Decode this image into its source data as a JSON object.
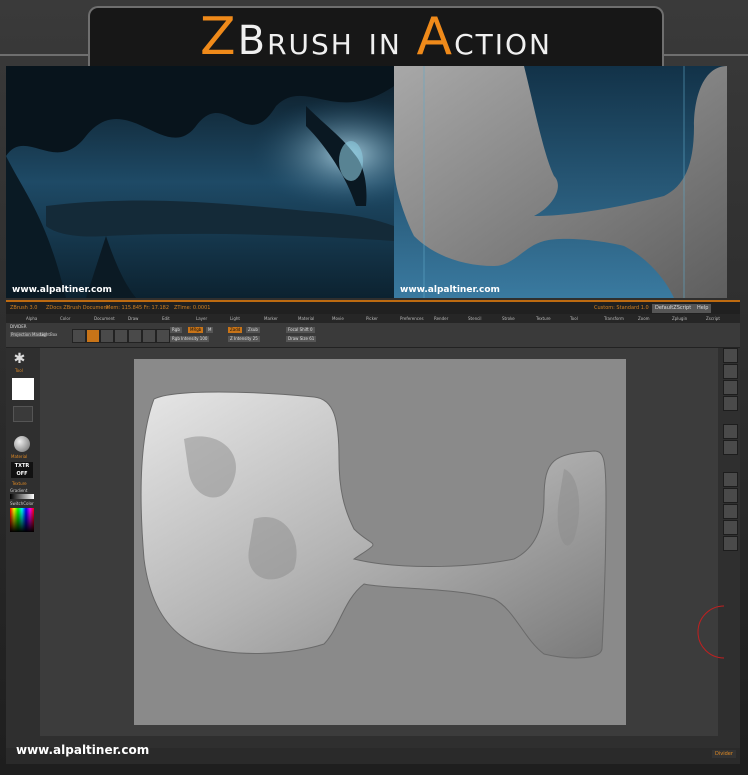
{
  "title": {
    "first_letter": "Z",
    "part1": "Brush in ",
    "second_letter": "A",
    "part2": "ction"
  },
  "images": {
    "left_watermark": "www.alpaltiner.com",
    "right_watermark": "www.alpaltiner.com"
  },
  "zbrush": {
    "titlebar": {
      "app": "ZBrush 3.0",
      "document": "ZDocs ZBrush Document",
      "mem": "Mem: 115.845 Fr: 17.182",
      "ztime": "ZTime: 0.0001",
      "right_label": "Custom: Standard 1.0",
      "btn1": "DefaultZScript",
      "btn2": "Help"
    },
    "menu": [
      "Alpha",
      "Color",
      "Document",
      "Draw",
      "Edit",
      "Layer",
      "Light",
      "Marker",
      "Material",
      "Movie",
      "Picker",
      "Preferences",
      "Render",
      "Stencil",
      "Stroke",
      "Texture",
      "Tool",
      "Transform",
      "Zoom",
      "Zplugin",
      "Zscript"
    ],
    "toolbar": {
      "divider": "DIVIDER",
      "projection": "Projection Master",
      "lightbox": "LightBox",
      "rgb": "Rgb",
      "mrgb": "MRgb",
      "m": "M",
      "zadd": "Zadd",
      "zsub": "Zsub",
      "focal_shift": "Focal Shift 0",
      "rgb_intensity": "Rgb Intensity 100",
      "z_intensity": "Z Intensity 25",
      "draw_size": "Draw Size 61",
      "buttons": [
        "Edit",
        "Draw",
        "Move",
        "Scale",
        "Rotate"
      ]
    },
    "left_shelf": {
      "tool_label": "Tool",
      "material_label": "Material",
      "texture": "TXTR OFF",
      "texture_label": "Texture",
      "alpha_label": "Alpha",
      "switch": "SwitchColor",
      "gradient": "Gradient"
    },
    "footer_divider": "Divider"
  },
  "footer": {
    "site": "www.alpaltiner.com"
  },
  "colors": {
    "accent": "#ef8a1a",
    "ui_bg": "#2f2f2f",
    "canvas": "#8a8a8a"
  }
}
